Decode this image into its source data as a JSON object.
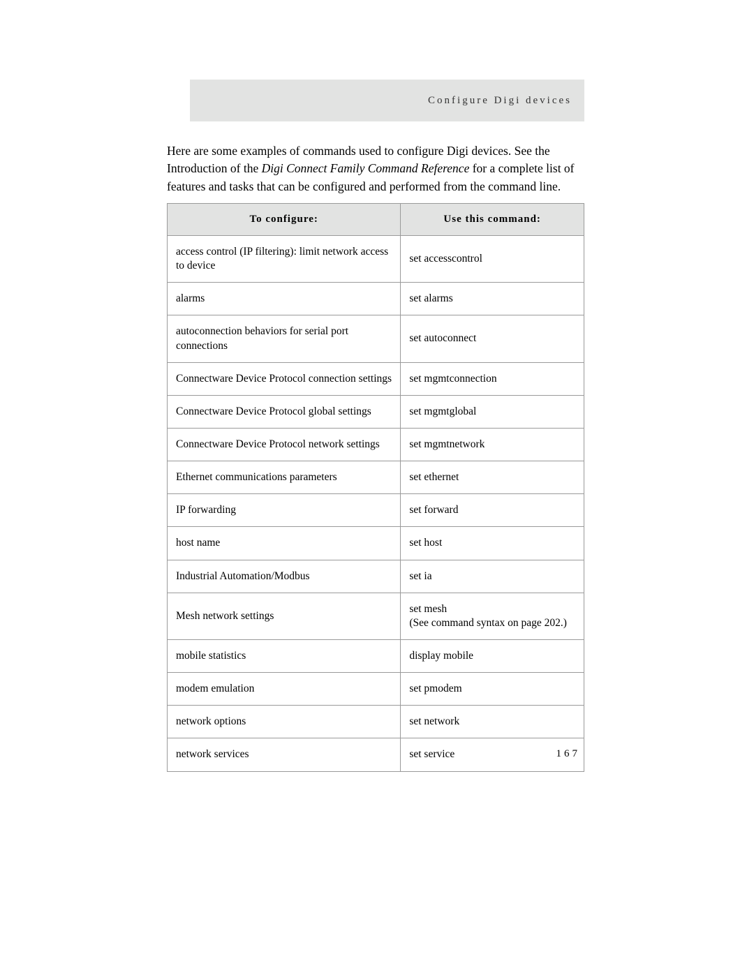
{
  "header": {
    "title": "Configure Digi devices"
  },
  "intro": {
    "part1": "Here are some examples of commands used to configure Digi devices. See the Introduction of the ",
    "italic": "Digi Connect Family Command Reference",
    "part2": " for a complete list of features and tasks that can be configured and performed from the command line."
  },
  "table": {
    "headers": {
      "left": "To configure:",
      "right": "Use this command:"
    },
    "rows": [
      {
        "left": "access control (IP filtering): limit network access to device",
        "right": "set accesscontrol"
      },
      {
        "left": "alarms",
        "right": "set alarms"
      },
      {
        "left": "autoconnection behaviors for serial port connections",
        "right": "set autoconnect"
      },
      {
        "left": "Connectware Device Protocol connection settings",
        "right": "set mgmtconnection"
      },
      {
        "left": "Connectware Device Protocol global settings",
        "right": "set mgmtglobal"
      },
      {
        "left": "Connectware Device Protocol network settings",
        "right": "set mgmtnetwork"
      },
      {
        "left": "Ethernet communications parameters",
        "right": "set ethernet"
      },
      {
        "left": "IP forwarding",
        "right": "set forward"
      },
      {
        "left": "host name",
        "right": "set host"
      },
      {
        "left": "Industrial Automation/Modbus",
        "right": "set ia"
      },
      {
        "left": "Mesh network settings",
        "right": "set mesh\n(See command syntax on page 202.)"
      },
      {
        "left": "mobile statistics",
        "right": "display mobile"
      },
      {
        "left": "modem emulation",
        "right": "set pmodem"
      },
      {
        "left": "network options",
        "right": "set network"
      },
      {
        "left": "network services",
        "right": "set service"
      }
    ]
  },
  "footer": {
    "page_number": "167"
  }
}
